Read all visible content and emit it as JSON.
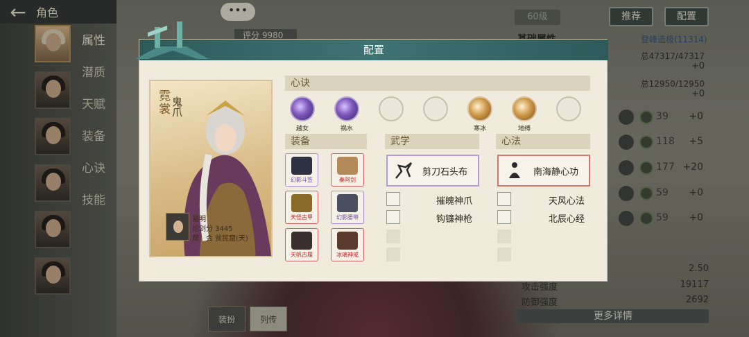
{
  "topbar": {
    "back_icon": "arrow-left-icon",
    "title": "角色"
  },
  "side_nav": [
    "属性",
    "潜质",
    "天赋",
    "装备",
    "心诀",
    "技能"
  ],
  "top_bubble": "•••",
  "score_tag": "评分 9980",
  "right": {
    "level": "60级",
    "recommend_label": "推荐",
    "config_label": "配置",
    "base_title": "基础属性",
    "peak_link": "登峰造极(11314)",
    "hp": "总47317/47317",
    "hp_delta": "+0",
    "mp": "总12950/12950",
    "mp_delta": "+0",
    "attributes": [
      {
        "value": "39",
        "plus": "+0"
      },
      {
        "value": "118",
        "plus": "+5"
      },
      {
        "value": "177",
        "plus": "+20"
      },
      {
        "value": "59",
        "plus": "+0"
      },
      {
        "value": "59",
        "plus": "+0"
      }
    ],
    "bottom_stats": [
      {
        "label": "",
        "value": "2.50"
      },
      {
        "label": "攻击强度",
        "value": "19117"
      },
      {
        "label": "防御强度",
        "value": "2692"
      }
    ],
    "detail_button": "更多详情"
  },
  "bottom_tabs": [
    "装扮",
    "列传"
  ],
  "modal": {
    "title": "配置",
    "card": {
      "name": "霓裳",
      "title": "鬼爪",
      "player_name": "易明",
      "rank_line": "论剑分 3445",
      "guild_line": "帮　会 贫民窟(天)"
    },
    "xinjue_header": "心诀",
    "xinjue": [
      {
        "label": "越女",
        "style": "purple"
      },
      {
        "label": "祸水",
        "style": "purple"
      },
      {
        "label": "",
        "style": "empty"
      },
      {
        "label": "",
        "style": "empty"
      },
      {
        "label": "寒冰",
        "style": "gold"
      },
      {
        "label": "地缚",
        "style": "gold"
      },
      {
        "label": "",
        "style": "empty"
      }
    ],
    "equip_header": "装备",
    "equipment": [
      {
        "label": "幻影斗笠",
        "tier": "violet",
        "color": "#2d3140"
      },
      {
        "label": "秦阿剑",
        "tier": "red",
        "color": "#b48a5a"
      },
      {
        "label": "天怪古甲",
        "tier": "red",
        "color": "#8a6a2a"
      },
      {
        "label": "幻影腰带",
        "tier": "violet",
        "color": "#4a5060"
      },
      {
        "label": "天帆古履",
        "tier": "red",
        "color": "#3a2e2e"
      },
      {
        "label": "冰璃神戒",
        "tier": "red",
        "color": "#5a3a2a"
      }
    ],
    "wuxue_header": "武学",
    "wuxue_main": "剪刀石头布",
    "wuxue_subs": [
      "摧魄神爪",
      "钩镰神枪"
    ],
    "xinfa_header": "心法",
    "xinfa_main": "南海静心功",
    "xinfa_subs": [
      "天风心法",
      "北辰心经"
    ]
  }
}
